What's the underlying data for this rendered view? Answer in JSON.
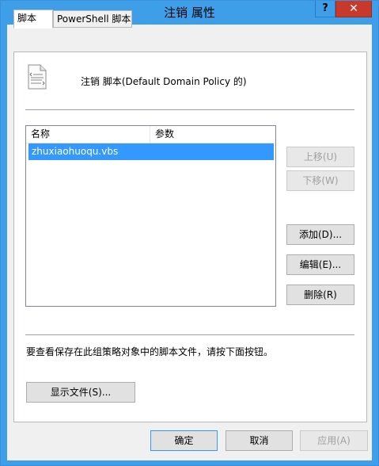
{
  "window": {
    "title": "注销 属性",
    "help_label": "?",
    "close_label": "✕"
  },
  "tabs": [
    {
      "label": "脚本",
      "active": true
    },
    {
      "label": "PowerShell 脚本",
      "active": false
    }
  ],
  "panel": {
    "icon": "script-file-icon",
    "heading": "注销 脚本(Default Domain Policy 的)",
    "list": {
      "columns": [
        "名称",
        "参数"
      ],
      "rows": [
        {
          "name": "zhuxiaohuoqu.vbs",
          "params": "",
          "selected": true
        }
      ]
    },
    "side_buttons": {
      "move_up": "上移(U)",
      "move_down": "下移(W)",
      "add": "添加(D)...",
      "edit": "编辑(E)...",
      "remove": "删除(R)"
    },
    "note": "要查看保存在此组策略对象中的脚本文件，请按下面按钮。",
    "show_files": "显示文件(S)..."
  },
  "footer": {
    "ok": "确定",
    "cancel": "取消",
    "apply": "应用(A)"
  },
  "colors": {
    "frame": "#3e9ee8",
    "close": "#c7392b",
    "selection": "#3399ff"
  }
}
